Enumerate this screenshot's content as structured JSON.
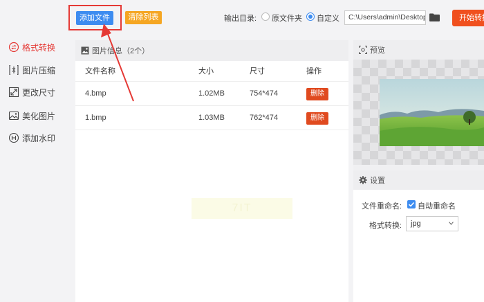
{
  "toolbar": {
    "add_file_label": "添加文件",
    "clear_list_label": "清除列表",
    "output_dir_label": "输出目录:",
    "radio_original_label": "原文件夹",
    "radio_custom_label": "自定义",
    "output_path_value": "C:\\Users\\admin\\Desktop",
    "start_button_label": "开始转换",
    "selected_output": "自定义"
  },
  "sidebar": {
    "items": [
      {
        "label": "格式转换",
        "icon": "format-convert-icon",
        "active": true
      },
      {
        "label": "图片压缩",
        "icon": "compress-icon",
        "active": false
      },
      {
        "label": "更改尺寸",
        "icon": "resize-icon",
        "active": false
      },
      {
        "label": "美化图片",
        "icon": "beautify-icon",
        "active": false
      },
      {
        "label": "添加水印",
        "icon": "watermark-icon",
        "active": false
      }
    ]
  },
  "file_panel": {
    "title": "图片信息（2个）",
    "columns": [
      "文件名称",
      "大小",
      "尺寸",
      "操作"
    ],
    "rows": [
      {
        "name": "4.bmp",
        "size": "1.02MB",
        "dimensions": "754*474",
        "action": "删除"
      },
      {
        "name": "1.bmp",
        "size": "1.03MB",
        "dimensions": "762*474",
        "action": "删除"
      }
    ],
    "watermark_text": "7IT"
  },
  "preview": {
    "title": "预览"
  },
  "settings": {
    "title": "设置",
    "rename_label": "文件重命名:",
    "auto_rename_label": "自动重命名",
    "auto_rename_checked": true,
    "format_label": "格式转换:",
    "format_value": "jpg"
  },
  "colors": {
    "accent_blue": "#3d8cf0",
    "accent_orange": "#f5a623",
    "start_red": "#f0501e",
    "delete_red": "#e04a1f",
    "highlight_red": "#e53935"
  }
}
